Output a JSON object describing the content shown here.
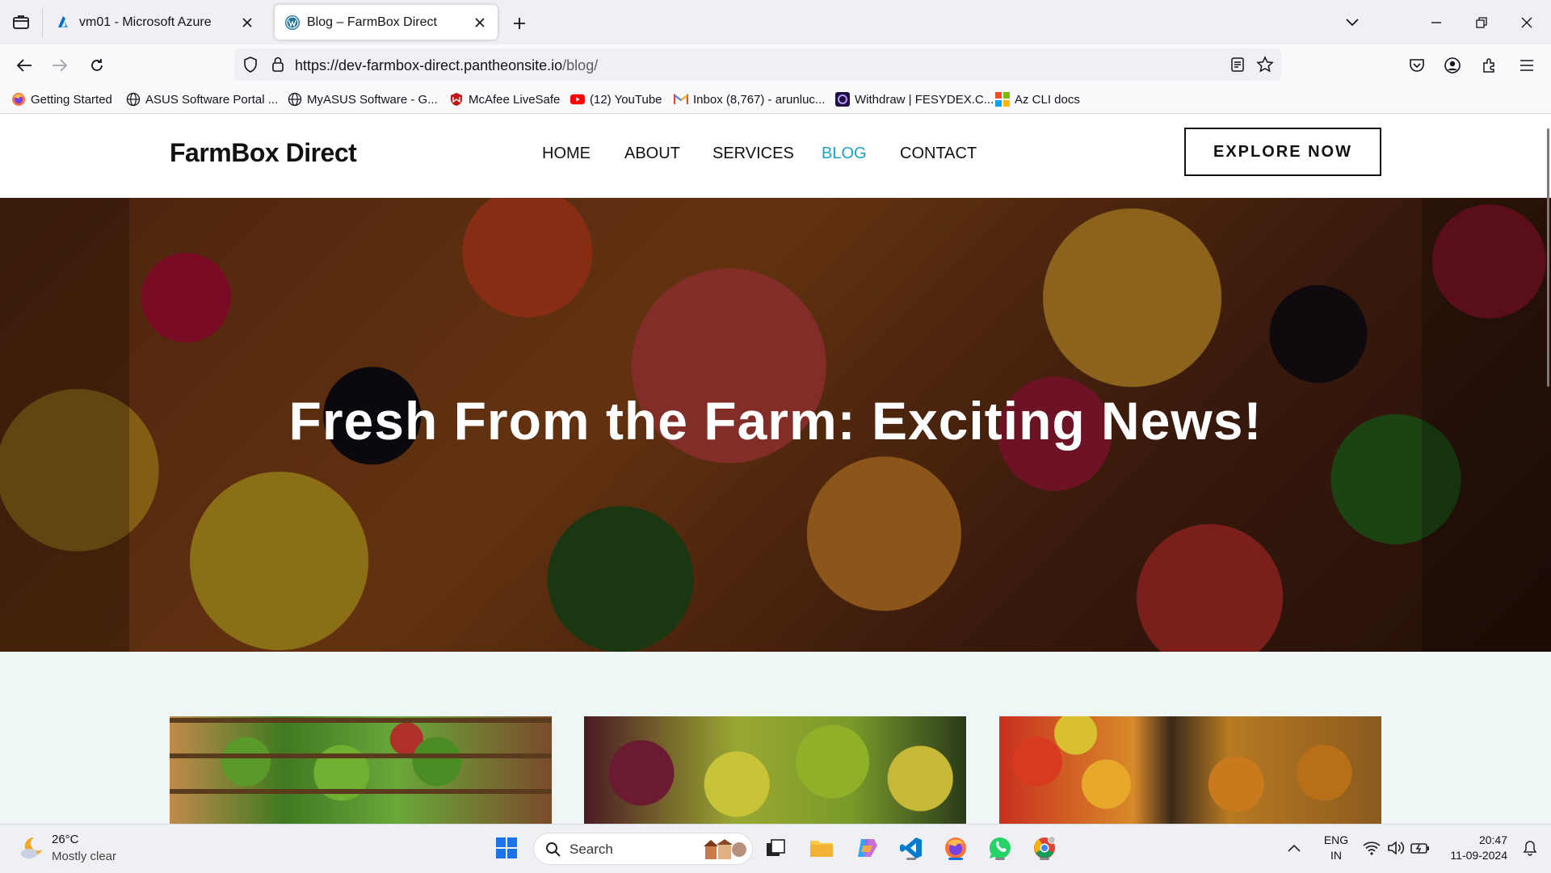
{
  "browser": {
    "tabs": [
      {
        "title": "vm01 - Microsoft Azure",
        "active": false,
        "icon": "azure-icon"
      },
      {
        "title": "Blog – FarmBox Direct",
        "active": true,
        "icon": "wordpress-icon"
      }
    ],
    "url_main": "https://dev-farmbox-direct.pantheonsite.io",
    "url_path": "/blog/",
    "bookmarks": [
      {
        "label": "Getting Started",
        "icon": "firefox-icon"
      },
      {
        "label": "ASUS Software Portal ...",
        "icon": "globe-icon"
      },
      {
        "label": "MyASUS Software - G...",
        "icon": "globe-icon"
      },
      {
        "label": "McAfee LiveSafe",
        "icon": "mcafee-icon"
      },
      {
        "label": "(12) YouTube",
        "icon": "youtube-icon"
      },
      {
        "label": "Inbox (8,767) - arunluc...",
        "icon": "gmail-icon"
      },
      {
        "label": "Withdraw | FESYDEX.C...",
        "icon": "fesydex-icon"
      },
      {
        "label": "Az CLI docs",
        "icon": "microsoft-icon"
      }
    ]
  },
  "site": {
    "logo": "FarmBox Direct",
    "menu": [
      {
        "label": "HOME",
        "active": false
      },
      {
        "label": "ABOUT",
        "active": false
      },
      {
        "label": "SERVICES",
        "active": false
      },
      {
        "label": "BLOG",
        "active": true
      },
      {
        "label": "CONTACT",
        "active": false
      }
    ],
    "cta": "EXPLORE NOW",
    "hero_title": "Fresh From the Farm: Exciting News!",
    "accent_color": "#1ba3c6"
  },
  "taskbar": {
    "temperature": "26°C",
    "condition": "Mostly clear",
    "search_label": "Search",
    "language_line1": "ENG",
    "language_line2": "IN",
    "time": "20:47",
    "date": "11-09-2024"
  }
}
